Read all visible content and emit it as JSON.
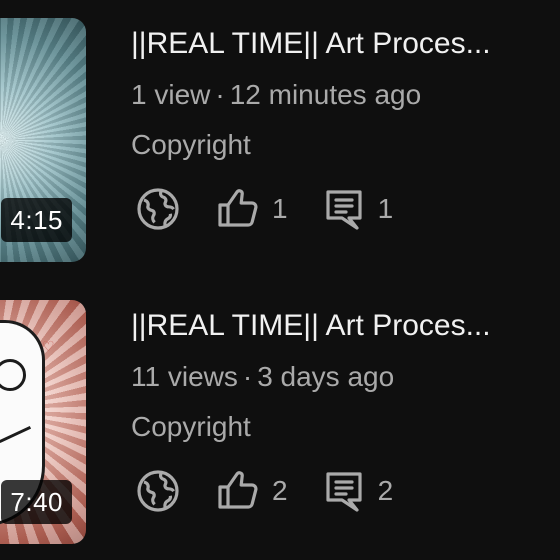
{
  "videos": [
    {
      "title": "||REAL TIME|| Art Proces...",
      "views": "1 view",
      "time_ago": "12 minutes ago",
      "license": "Copyright",
      "duration": "4:15",
      "likes": "1",
      "comments": "1",
      "visibility_icon": "globe-icon"
    },
    {
      "title": "||REAL TIME|| Art Proces...",
      "views": "11 views",
      "time_ago": "3 days ago",
      "license": "Copyright",
      "duration": "7:40",
      "likes": "2",
      "comments": "2",
      "visibility_icon": "globe-icon"
    }
  ],
  "separator": "·",
  "colors": {
    "background": "#0f0f0f",
    "primary_text": "#f1f1f1",
    "secondary_text": "#aaaaaa"
  }
}
